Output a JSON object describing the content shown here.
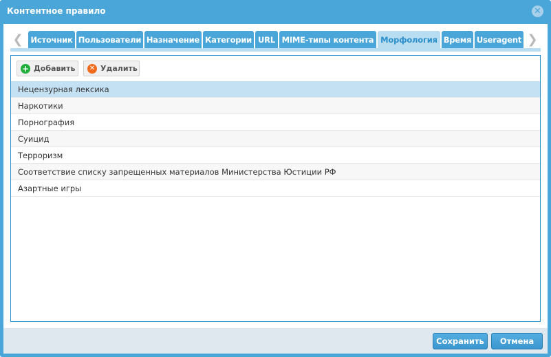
{
  "dialog": {
    "title": "Контентное правило",
    "close_icon": "close-circle-icon"
  },
  "tabs": [
    {
      "label": "Источник"
    },
    {
      "label": "Пользователи"
    },
    {
      "label": "Назначение"
    },
    {
      "label": "Категории"
    },
    {
      "label": "URL"
    },
    {
      "label": "MIME-типы контента"
    },
    {
      "label": "Морфология",
      "active": true
    },
    {
      "label": "Время"
    },
    {
      "label": "Useragent"
    }
  ],
  "tab_nav": {
    "prev": "❮",
    "next": "❯"
  },
  "toolbar": {
    "add_label": "Добавить",
    "add_icon": "plus-circle-icon",
    "add_color": "#1fae3a",
    "delete_label": "Удалить",
    "delete_icon": "x-circle-icon",
    "delete_color": "#f26b1d"
  },
  "list": {
    "items": [
      "Нецензурная лексика",
      "Наркотики",
      "Порнография",
      "Суицид",
      "Терроризм",
      "Соответствие списку запрещенных материалов Министерства Юстиции РФ",
      "Азартные игры"
    ],
    "selected_index": 0
  },
  "footer": {
    "save_label": "Сохранить",
    "cancel_label": "Отмена"
  }
}
